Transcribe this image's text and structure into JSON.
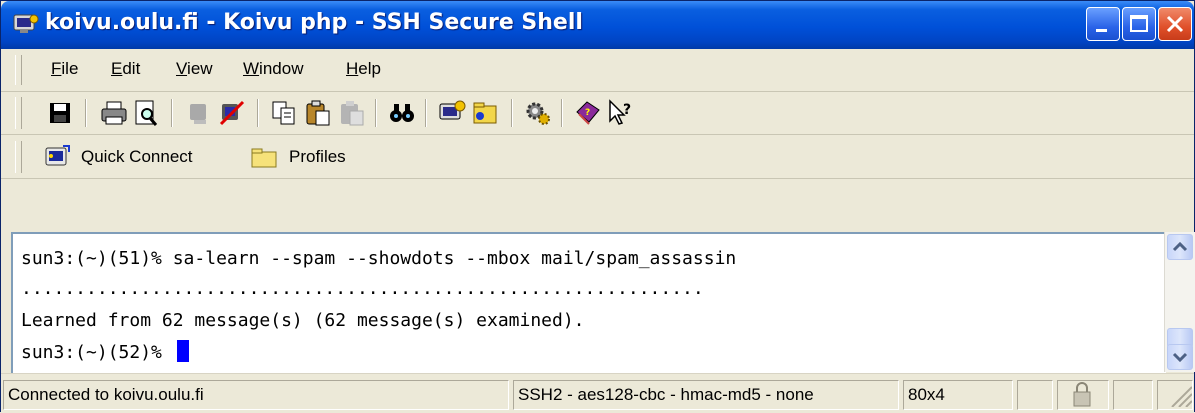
{
  "window": {
    "title": "koivu.oulu.fi - Koivu php - SSH Secure Shell",
    "colors": {
      "titlebar": "#0050d8",
      "cursor": "#0000ff",
      "close": "#e0502a"
    }
  },
  "menu": {
    "items": [
      {
        "label_u": "F",
        "label_rest": "ile"
      },
      {
        "label_u": "E",
        "label_rest": "dit"
      },
      {
        "label_u": "V",
        "label_rest": "iew"
      },
      {
        "label_u": "W",
        "label_rest": "indow"
      },
      {
        "label_u": "H",
        "label_rest": "elp"
      }
    ]
  },
  "toolbar": {
    "icons": [
      "save-icon",
      "print-icon",
      "print-preview-icon",
      "connect-disabled-icon",
      "disconnect-icon",
      "copy-icon",
      "paste-icon",
      "paste-disabled-icon",
      "find-icon",
      "new-terminal-icon",
      "new-file-transfer-icon",
      "settings-icon",
      "help-book-icon",
      "context-help-icon"
    ]
  },
  "quickbar": {
    "quick_connect": "Quick Connect",
    "profiles": "Profiles"
  },
  "terminal": {
    "lines": [
      "sun3:(~)(51)% sa-learn --spam --showdots --mbox mail/spam_assassin",
      "...............................................................",
      "Learned from 62 message(s) (62 message(s) examined).",
      "sun3:(~)(52)% "
    ]
  },
  "status": {
    "connection": "Connected to koivu.oulu.fi",
    "cipher": "SSH2 - aes128-cbc - hmac-md5 - none",
    "size": "80x4"
  }
}
